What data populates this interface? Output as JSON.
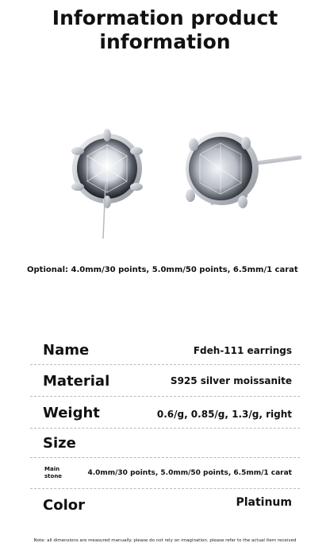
{
  "title": {
    "line1": "Information product",
    "line2": "information"
  },
  "optional_text": "Optional: 4.0mm/30 points, 5.0mm/50 points, 6.5mm/1 carat",
  "specs": [
    {
      "label": "Name",
      "value": "Fdeh-111 earrings"
    },
    {
      "label": "Material",
      "value": "S925 silver moissanite"
    },
    {
      "label": "Weight",
      "value": "0.6/g, 0.85/g, 1.3/g, right"
    },
    {
      "label": "Size",
      "value": ""
    },
    {
      "label": "Main stone",
      "value": "4.0mm/30 points, 5.0mm/50 points, 6.5mm/1 carat"
    },
    {
      "label": "Color",
      "value": "Platinum"
    }
  ],
  "note": "Note: all dimensions are measured manually. please do not rely on imagination. please refer to the actual item received"
}
